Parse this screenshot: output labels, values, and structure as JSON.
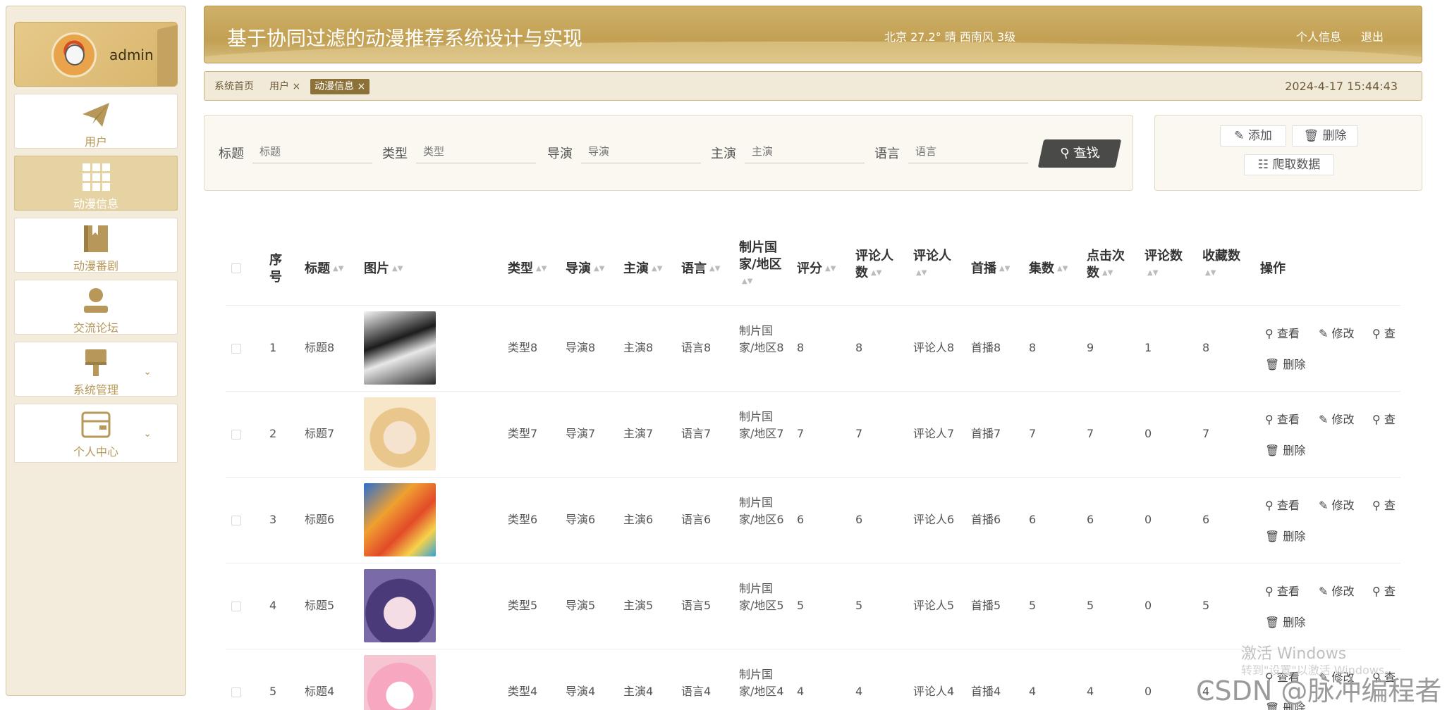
{
  "sidebar": {
    "username": "admin",
    "items": [
      {
        "label": "用户",
        "icon": "paper-plane-icon"
      },
      {
        "label": "动漫信息",
        "icon": "grid-icon"
      },
      {
        "label": "动漫番剧",
        "icon": "book-icon"
      },
      {
        "label": "交流论坛",
        "icon": "user-icon"
      },
      {
        "label": "系统管理",
        "icon": "brush-icon"
      },
      {
        "label": "个人中心",
        "icon": "card-icon"
      }
    ]
  },
  "header": {
    "title": "基于协同过滤的动漫推荐系统设计与实现",
    "weather": "北京  27.2°  晴  西南风  3级",
    "profile_label": "个人信息",
    "logout_label": "退出"
  },
  "tabs": {
    "items": [
      "系统首页",
      "用户 ×",
      "动漫信息 ×"
    ],
    "datetime": "2024-4-17 15:44:43"
  },
  "search": {
    "fields": [
      {
        "label": "标题",
        "placeholder": "标题"
      },
      {
        "label": "类型",
        "placeholder": "类型"
      },
      {
        "label": "导演",
        "placeholder": "导演"
      },
      {
        "label": "主演",
        "placeholder": "主演"
      },
      {
        "label": "语言",
        "placeholder": "语言"
      }
    ],
    "button_label": "查找"
  },
  "actions": {
    "add_label": "添加",
    "delete_label": "删除",
    "crawl_label": "爬取数据"
  },
  "table": {
    "headers": {
      "index": "序号",
      "title": "标题",
      "image": "图片",
      "type": "类型",
      "director": "导演",
      "actor": "主演",
      "language": "语言",
      "country": "制片国家/地区",
      "rating": "评分",
      "reviewers_count": "评论人数",
      "reviewer": "评论人",
      "premiere": "首播",
      "episodes": "集数",
      "clicks": "点击次数",
      "comments": "评论数",
      "favorites": "收藏数",
      "ops": "操作"
    },
    "ops": {
      "view": "查看",
      "edit": "修改",
      "view2": "查",
      "delete": "删除"
    },
    "rows": [
      {
        "index": "1",
        "title": "标题8",
        "type": "类型8",
        "director": "导演8",
        "actor": "主演8",
        "language": "语言8",
        "country": "制片国家/地区8",
        "rating": "8",
        "reviewers_count": "8",
        "reviewer": "评论人8",
        "premiere": "首播8",
        "episodes": "8",
        "clicks": "9",
        "comments": "1",
        "favorites": "8"
      },
      {
        "index": "2",
        "title": "标题7",
        "type": "类型7",
        "director": "导演7",
        "actor": "主演7",
        "language": "语言7",
        "country": "制片国家/地区7",
        "rating": "7",
        "reviewers_count": "7",
        "reviewer": "评论人7",
        "premiere": "首播7",
        "episodes": "7",
        "clicks": "7",
        "comments": "0",
        "favorites": "7"
      },
      {
        "index": "3",
        "title": "标题6",
        "type": "类型6",
        "director": "导演6",
        "actor": "主演6",
        "language": "语言6",
        "country": "制片国家/地区6",
        "rating": "6",
        "reviewers_count": "6",
        "reviewer": "评论人6",
        "premiere": "首播6",
        "episodes": "6",
        "clicks": "6",
        "comments": "0",
        "favorites": "6"
      },
      {
        "index": "4",
        "title": "标题5",
        "type": "类型5",
        "director": "导演5",
        "actor": "主演5",
        "language": "语言5",
        "country": "制片国家/地区5",
        "rating": "5",
        "reviewers_count": "5",
        "reviewer": "评论人5",
        "premiere": "首播5",
        "episodes": "5",
        "clicks": "5",
        "comments": "0",
        "favorites": "5"
      },
      {
        "index": "5",
        "title": "标题4",
        "type": "类型4",
        "director": "导演4",
        "actor": "主演4",
        "language": "语言4",
        "country": "制片国家/地区4",
        "rating": "4",
        "reviewers_count": "4",
        "reviewer": "评论人4",
        "premiere": "首播4",
        "episodes": "4",
        "clicks": "4",
        "comments": "0",
        "favorites": "4"
      }
    ]
  },
  "watermark": {
    "activate": "激活 Windows",
    "hint": "转到\"设置\"以激活 Windows。",
    "csdn": "CSDN @脉冲编程者"
  }
}
